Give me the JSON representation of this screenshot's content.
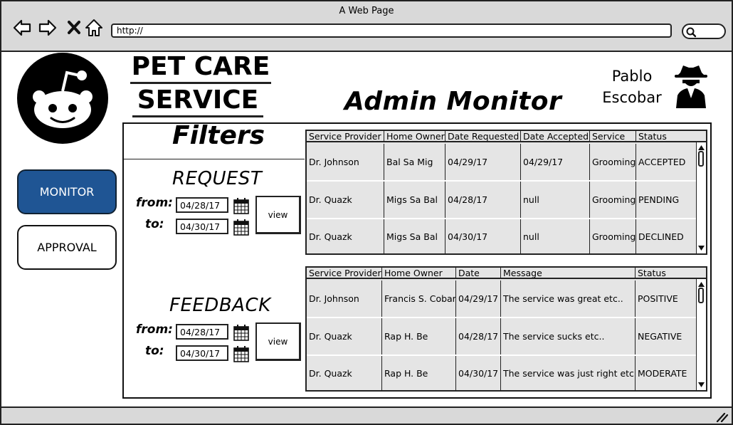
{
  "window": {
    "title": "A Web Page",
    "url": "http://"
  },
  "header": {
    "app_title_line1": "PET CARE",
    "app_title_line2": "SERVICE",
    "page_title": "Admin Monitor",
    "user_first": "Pablo",
    "user_last": "Escobar"
  },
  "sidebar": {
    "items": [
      {
        "label": "MONITOR",
        "active": true
      },
      {
        "label": "APPROVAL",
        "active": false
      }
    ]
  },
  "filters": {
    "title": "Filters",
    "request": {
      "title": "REQUEST",
      "from_label": "from:",
      "to_label": "to:",
      "from_value": "04/28/17",
      "to_value": "04/30/17",
      "view_label": "view"
    },
    "feedback": {
      "title": "FEEDBACK",
      "from_label": "from:",
      "to_label": "to:",
      "from_value": "04/28/17",
      "to_value": "04/30/17",
      "view_label": "view"
    }
  },
  "requests_table": {
    "columns": [
      "Service Provider",
      "Home Owner",
      "Date Requested",
      "Date Accepted",
      "Service",
      "Status"
    ],
    "rows": [
      [
        "Dr. Johnson",
        "Bal Sa Mig",
        "04/29/17",
        "04/29/17",
        "Grooming",
        "ACCEPTED"
      ],
      [
        "Dr. Quazk",
        "Migs Sa Bal",
        "04/28/17",
        "null",
        "Grooming",
        "PENDING"
      ],
      [
        "Dr. Quazk",
        "Migs Sa Bal",
        "04/30/17",
        "null",
        "Grooming",
        "DECLINED"
      ]
    ]
  },
  "feedback_table": {
    "columns": [
      "Service Provider",
      "Home Owner",
      "Date",
      "Message",
      "Status"
    ],
    "rows": [
      [
        "Dr. Johnson",
        "Francis S. Cobar",
        "04/29/17",
        "The service was great etc..",
        "POSITIVE"
      ],
      [
        "Dr. Quazk",
        "Rap H. Be",
        "04/28/17",
        "The service sucks etc..",
        "NEGATIVE"
      ],
      [
        "Dr. Quazk",
        "Rap H. Be",
        "04/30/17",
        "The service was just right etc..",
        "MODERATE"
      ]
    ]
  },
  "colors": {
    "accent": "#1f5594",
    "chrome": "#d9d9d9",
    "grid_bg": "#e5e5e5"
  }
}
